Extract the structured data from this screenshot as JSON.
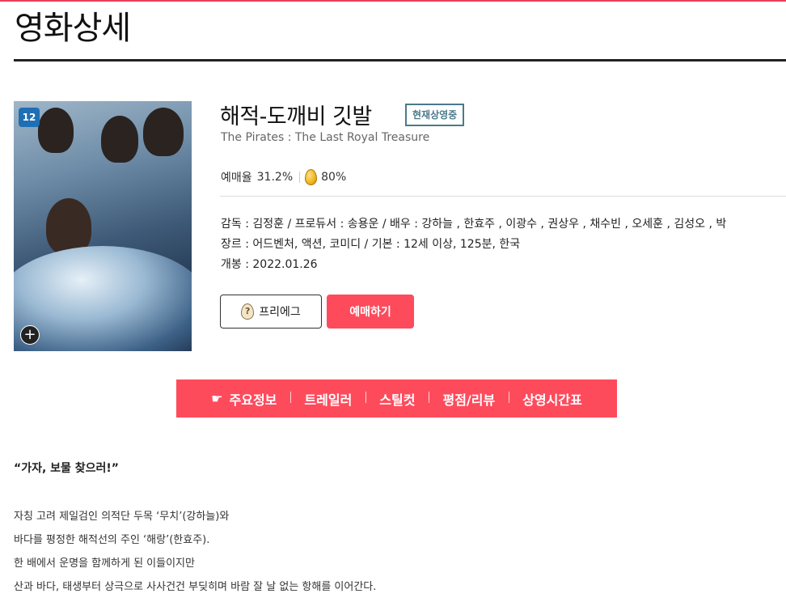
{
  "page": {
    "title": "영화상세"
  },
  "poster": {
    "age_rating": "12",
    "expand_icon": "plus-icon"
  },
  "movie": {
    "title": "해적-도깨비 깃발",
    "status": "현재상영중",
    "title_en": "The Pirates : The Last Royal Treasure",
    "reservation_label": "예매율",
    "reservation_rate": "31.2%",
    "egg_rate": "80%",
    "crew": "감독 : 김정훈 / 프로듀서 : 송용운 / 배우 : 강하늘 ,  한효주 ,  이광수 ,  권상우 ,  채수빈 ,  오세훈 ,  김성오 ,  박",
    "genre": "장르 : 어드벤처, 액션, 코미디 / 기본 : 12세 이상, 125분, 한국",
    "release": "개봉 : 2022.01.26"
  },
  "buttons": {
    "preegg": "프리에그",
    "preegg_icon_glyph": "?",
    "reserve": "예매하기"
  },
  "tabs": [
    {
      "label": "주요정보"
    },
    {
      "label": "트레일러"
    },
    {
      "label": "스틸컷"
    },
    {
      "label": "평점/리뷰"
    },
    {
      "label": "상영시간표"
    }
  ],
  "content": {
    "tagline": "“가자, 보물 찾으러!”",
    "synopsis": [
      "자칭 고려 제일검인 의적단 두목 ‘무치’(강하늘)와",
      "바다를 평정한 해적선의 주인 ‘해랑’(한효주).",
      "한 배에서 운명을 함께하게 된 이들이지만",
      "산과 바다, 태생부터 상극으로 사사건건 부딪히며 바람 잘 날 없는 항해를 이어간다."
    ]
  },
  "colors": {
    "accent": "#fe4b5c",
    "status_badge": "#4a7a8c",
    "age_badge": "#1f6fb4"
  }
}
